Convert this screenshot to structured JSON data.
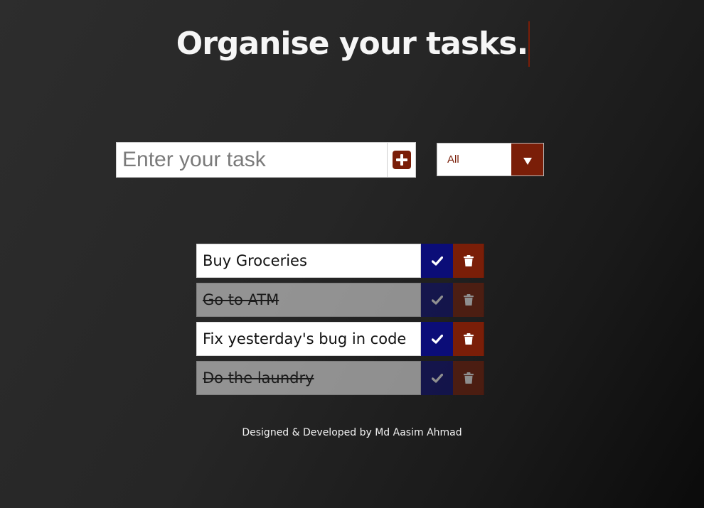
{
  "header": {
    "title": "Organise your tasks."
  },
  "task_form": {
    "placeholder": "Enter your task",
    "value": "",
    "add_icon": "plus-square-icon"
  },
  "filter": {
    "selected": "All",
    "arrow_icon": "caret-down-icon"
  },
  "todos": [
    {
      "text": "Buy Groceries",
      "completed": false
    },
    {
      "text": "Go to ATM",
      "completed": true
    },
    {
      "text": "Fix yesterday's bug in code",
      "completed": false
    },
    {
      "text": "Do the laundry",
      "completed": true
    }
  ],
  "actions": {
    "complete_icon": "check-icon",
    "delete_icon": "trash-icon"
  },
  "colors": {
    "accent_red": "#7a1e08",
    "accent_blue": "#0b0d78"
  },
  "footer": {
    "credit": "Designed & Developed by Md Aasim Ahmad"
  }
}
